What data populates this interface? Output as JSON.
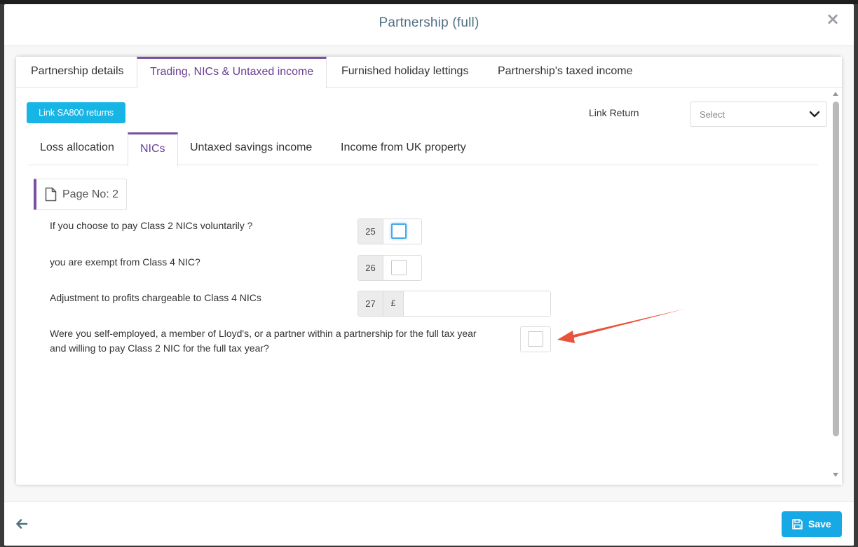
{
  "modal": {
    "title": "Partnership (full)",
    "close_icon": "close-icon"
  },
  "top_tabs": [
    {
      "label": "Partnership details",
      "active": false
    },
    {
      "label": "Trading, NICs & Untaxed income",
      "active": true
    },
    {
      "label": "Furnished holiday lettings",
      "active": false
    },
    {
      "label": "Partnership's taxed income",
      "active": false
    }
  ],
  "toolbar": {
    "link_sa800_label": "Link SA800 returns",
    "link_return_label": "Link Return",
    "link_return_select": {
      "value": "Select"
    }
  },
  "sub_tabs": [
    {
      "label": "Loss allocation",
      "active": false
    },
    {
      "label": "NICs",
      "active": true
    },
    {
      "label": "Untaxed savings income",
      "active": false
    },
    {
      "label": "Income from UK property",
      "active": false
    }
  ],
  "page_indicator": {
    "label": "Page No: 2"
  },
  "questions": [
    {
      "label": "If you choose to pay Class 2 NICs voluntarily ?",
      "box": "25",
      "type": "checkbox",
      "checked": false,
      "focused": true
    },
    {
      "label": "you are exempt from Class 4 NIC?",
      "box": "26",
      "type": "checkbox",
      "checked": false
    },
    {
      "label": "Adjustment to profits chargeable to Class 4 NICs",
      "box": "27",
      "type": "amount",
      "currency": "£",
      "value": ""
    },
    {
      "label": "Were you self-employed, a member of Lloyd's, or a partner within a partnership for the full tax year and willing to pay Class 2 NIC for the full tax year?",
      "type": "checkbox",
      "checked": false
    }
  ],
  "footer": {
    "back_icon": "arrow-left-icon",
    "save_label": "Save",
    "save_icon": "floppy-disk-icon"
  },
  "colors": {
    "accent_purple": "#7a4fa0",
    "primary_blue": "#17a8e6",
    "title_color": "#4f6f83",
    "annotation_red": "#e8533c"
  }
}
